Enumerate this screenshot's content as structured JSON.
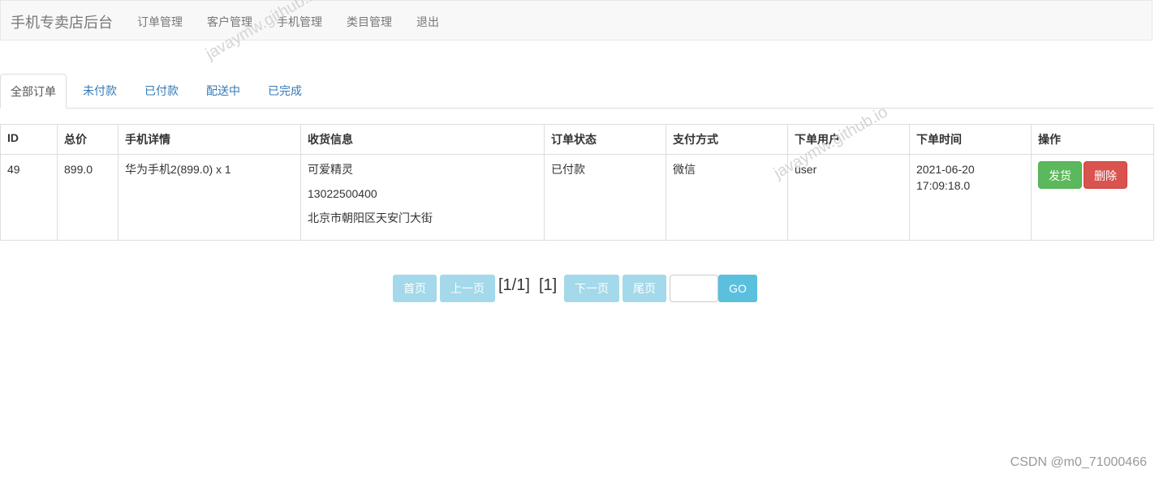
{
  "navbar": {
    "brand": "手机专卖店后台",
    "links": [
      "订单管理",
      "客户管理",
      "手机管理",
      "类目管理",
      "退出"
    ]
  },
  "tabs": [
    "全部订单",
    "未付款",
    "已付款",
    "配送中",
    "已完成"
  ],
  "table": {
    "headers": [
      "ID",
      "总价",
      "手机详情",
      "收货信息",
      "订单状态",
      "支付方式",
      "下单用户",
      "下单时间",
      "操作"
    ],
    "rows": [
      {
        "id": "49",
        "total": "899.0",
        "phone": "华为手机2(899.0) x 1",
        "receiver_name": "可爱精灵",
        "receiver_phone": "13022500400",
        "receiver_address": "北京市朝阳区天安门大街",
        "status": "已付款",
        "payment": "微信",
        "user": "user",
        "date": "2021-06-20",
        "time": "17:09:18.0",
        "ship_label": "发货",
        "delete_label": "删除"
      }
    ]
  },
  "pagination": {
    "first": "首页",
    "prev": "上一页",
    "page_info": "[1/1]",
    "current": "[1]",
    "next": "下一页",
    "last": "尾页",
    "go": "GO"
  },
  "watermark": "javaymw.github.io",
  "credit": "CSDN @m0_71000466",
  "colors": {
    "status_paid": "#c9302c",
    "ship_button": "#5cb85c",
    "delete_button": "#d9534f",
    "go_button": "#5bc0de",
    "pager_button": "#a3d9ea",
    "link": "#337ab7"
  }
}
